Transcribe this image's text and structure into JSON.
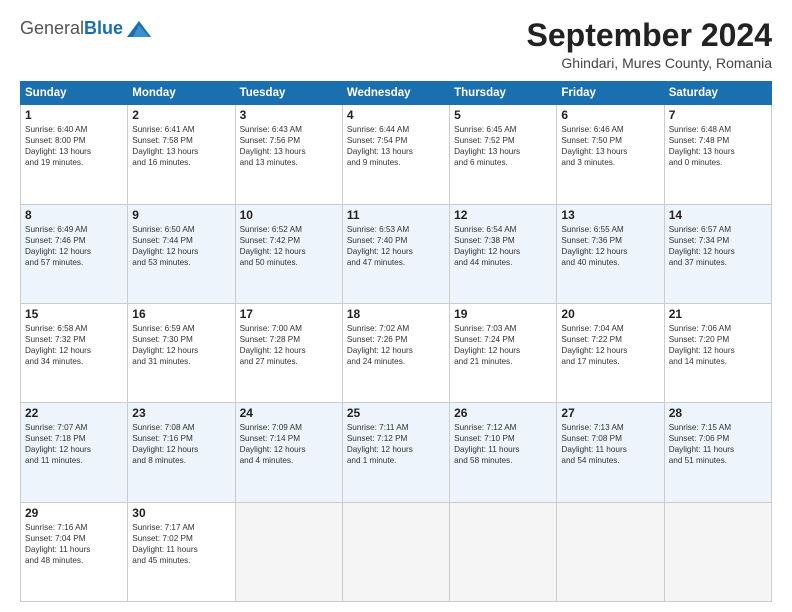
{
  "header": {
    "logo_general": "General",
    "logo_blue": "Blue",
    "month_year": "September 2024",
    "location": "Ghindari, Mures County, Romania"
  },
  "days_of_week": [
    "Sunday",
    "Monday",
    "Tuesday",
    "Wednesday",
    "Thursday",
    "Friday",
    "Saturday"
  ],
  "weeks": [
    [
      {
        "day": "1",
        "lines": [
          "Sunrise: 6:40 AM",
          "Sunset: 8:00 PM",
          "Daylight: 13 hours",
          "and 19 minutes."
        ]
      },
      {
        "day": "2",
        "lines": [
          "Sunrise: 6:41 AM",
          "Sunset: 7:58 PM",
          "Daylight: 13 hours",
          "and 16 minutes."
        ]
      },
      {
        "day": "3",
        "lines": [
          "Sunrise: 6:43 AM",
          "Sunset: 7:56 PM",
          "Daylight: 13 hours",
          "and 13 minutes."
        ]
      },
      {
        "day": "4",
        "lines": [
          "Sunrise: 6:44 AM",
          "Sunset: 7:54 PM",
          "Daylight: 13 hours",
          "and 9 minutes."
        ]
      },
      {
        "day": "5",
        "lines": [
          "Sunrise: 6:45 AM",
          "Sunset: 7:52 PM",
          "Daylight: 13 hours",
          "and 6 minutes."
        ]
      },
      {
        "day": "6",
        "lines": [
          "Sunrise: 6:46 AM",
          "Sunset: 7:50 PM",
          "Daylight: 13 hours",
          "and 3 minutes."
        ]
      },
      {
        "day": "7",
        "lines": [
          "Sunrise: 6:48 AM",
          "Sunset: 7:48 PM",
          "Daylight: 13 hours",
          "and 0 minutes."
        ]
      }
    ],
    [
      {
        "day": "8",
        "lines": [
          "Sunrise: 6:49 AM",
          "Sunset: 7:46 PM",
          "Daylight: 12 hours",
          "and 57 minutes."
        ]
      },
      {
        "day": "9",
        "lines": [
          "Sunrise: 6:50 AM",
          "Sunset: 7:44 PM",
          "Daylight: 12 hours",
          "and 53 minutes."
        ]
      },
      {
        "day": "10",
        "lines": [
          "Sunrise: 6:52 AM",
          "Sunset: 7:42 PM",
          "Daylight: 12 hours",
          "and 50 minutes."
        ]
      },
      {
        "day": "11",
        "lines": [
          "Sunrise: 6:53 AM",
          "Sunset: 7:40 PM",
          "Daylight: 12 hours",
          "and 47 minutes."
        ]
      },
      {
        "day": "12",
        "lines": [
          "Sunrise: 6:54 AM",
          "Sunset: 7:38 PM",
          "Daylight: 12 hours",
          "and 44 minutes."
        ]
      },
      {
        "day": "13",
        "lines": [
          "Sunrise: 6:55 AM",
          "Sunset: 7:36 PM",
          "Daylight: 12 hours",
          "and 40 minutes."
        ]
      },
      {
        "day": "14",
        "lines": [
          "Sunrise: 6:57 AM",
          "Sunset: 7:34 PM",
          "Daylight: 12 hours",
          "and 37 minutes."
        ]
      }
    ],
    [
      {
        "day": "15",
        "lines": [
          "Sunrise: 6:58 AM",
          "Sunset: 7:32 PM",
          "Daylight: 12 hours",
          "and 34 minutes."
        ]
      },
      {
        "day": "16",
        "lines": [
          "Sunrise: 6:59 AM",
          "Sunset: 7:30 PM",
          "Daylight: 12 hours",
          "and 31 minutes."
        ]
      },
      {
        "day": "17",
        "lines": [
          "Sunrise: 7:00 AM",
          "Sunset: 7:28 PM",
          "Daylight: 12 hours",
          "and 27 minutes."
        ]
      },
      {
        "day": "18",
        "lines": [
          "Sunrise: 7:02 AM",
          "Sunset: 7:26 PM",
          "Daylight: 12 hours",
          "and 24 minutes."
        ]
      },
      {
        "day": "19",
        "lines": [
          "Sunrise: 7:03 AM",
          "Sunset: 7:24 PM",
          "Daylight: 12 hours",
          "and 21 minutes."
        ]
      },
      {
        "day": "20",
        "lines": [
          "Sunrise: 7:04 AM",
          "Sunset: 7:22 PM",
          "Daylight: 12 hours",
          "and 17 minutes."
        ]
      },
      {
        "day": "21",
        "lines": [
          "Sunrise: 7:06 AM",
          "Sunset: 7:20 PM",
          "Daylight: 12 hours",
          "and 14 minutes."
        ]
      }
    ],
    [
      {
        "day": "22",
        "lines": [
          "Sunrise: 7:07 AM",
          "Sunset: 7:18 PM",
          "Daylight: 12 hours",
          "and 11 minutes."
        ]
      },
      {
        "day": "23",
        "lines": [
          "Sunrise: 7:08 AM",
          "Sunset: 7:16 PM",
          "Daylight: 12 hours",
          "and 8 minutes."
        ]
      },
      {
        "day": "24",
        "lines": [
          "Sunrise: 7:09 AM",
          "Sunset: 7:14 PM",
          "Daylight: 12 hours",
          "and 4 minutes."
        ]
      },
      {
        "day": "25",
        "lines": [
          "Sunrise: 7:11 AM",
          "Sunset: 7:12 PM",
          "Daylight: 12 hours",
          "and 1 minute."
        ]
      },
      {
        "day": "26",
        "lines": [
          "Sunrise: 7:12 AM",
          "Sunset: 7:10 PM",
          "Daylight: 11 hours",
          "and 58 minutes."
        ]
      },
      {
        "day": "27",
        "lines": [
          "Sunrise: 7:13 AM",
          "Sunset: 7:08 PM",
          "Daylight: 11 hours",
          "and 54 minutes."
        ]
      },
      {
        "day": "28",
        "lines": [
          "Sunrise: 7:15 AM",
          "Sunset: 7:06 PM",
          "Daylight: 11 hours",
          "and 51 minutes."
        ]
      }
    ],
    [
      {
        "day": "29",
        "lines": [
          "Sunrise: 7:16 AM",
          "Sunset: 7:04 PM",
          "Daylight: 11 hours",
          "and 48 minutes."
        ]
      },
      {
        "day": "30",
        "lines": [
          "Sunrise: 7:17 AM",
          "Sunset: 7:02 PM",
          "Daylight: 11 hours",
          "and 45 minutes."
        ]
      },
      {
        "day": "",
        "lines": []
      },
      {
        "day": "",
        "lines": []
      },
      {
        "day": "",
        "lines": []
      },
      {
        "day": "",
        "lines": []
      },
      {
        "day": "",
        "lines": []
      }
    ]
  ]
}
